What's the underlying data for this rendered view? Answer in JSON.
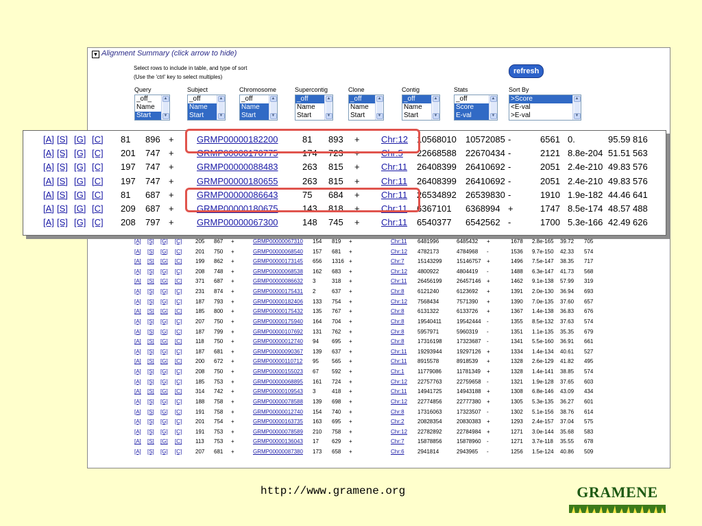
{
  "summary": {
    "title": "Alignment Summary",
    "hint": "(click arrow to hide)",
    "instruction_1": "Select rows to include in table, and type of sort",
    "instruction_2": "(Use the 'ctrl' key to select multiples)",
    "refresh_label": "refresh",
    "arrow_glyph": "▼"
  },
  "selectors": [
    {
      "label": "Query",
      "options": [
        "_off_",
        "Name",
        "Start"
      ],
      "selected": [
        2
      ]
    },
    {
      "label": "Subject",
      "options": [
        "_off",
        "Name",
        "Start"
      ],
      "selected": [
        1,
        2
      ]
    },
    {
      "label": "Chromosome",
      "options": [
        "_off",
        "Name",
        "Start"
      ],
      "selected": [
        1,
        2
      ]
    },
    {
      "label": "Supercontig",
      "options": [
        "_off",
        "Name",
        "Start"
      ],
      "selected": [
        0
      ]
    },
    {
      "label": "Clone",
      "options": [
        "_off",
        "Name",
        "Start"
      ],
      "selected": [
        0
      ]
    },
    {
      "label": "Contig",
      "options": [
        "_off",
        "Name",
        "Start"
      ],
      "selected": [
        0
      ]
    },
    {
      "label": "Stats",
      "options": [
        "_off",
        "Score",
        "E-val"
      ],
      "selected": [
        1,
        2
      ]
    },
    {
      "label": "Sort By",
      "options": [
        ">Score",
        "<E-val",
        ">E-val"
      ],
      "selected": [
        0
      ]
    }
  ],
  "popup_rows": [
    [
      "[A]",
      "[S]",
      "[G]",
      "[C]",
      "81",
      "896",
      "+",
      "GRMP00000182200",
      "81",
      "893",
      "+",
      "Chr:12",
      "10568010",
      "10572085",
      "-",
      "6561",
      "0.",
      "95.59",
      "816"
    ],
    [
      "[A]",
      "[S]",
      "[G]",
      "[C]",
      "201",
      "747",
      "+",
      "GRMP00000170775",
      "174",
      "723",
      "+",
      "Chr:5",
      "22668588",
      "22670434",
      "-",
      "2121",
      "8.8e-204",
      "51.51",
      "563"
    ],
    [
      "[A]",
      "[S]",
      "[G]",
      "[C]",
      "197",
      "747",
      "+",
      "GRMP00000088483",
      "263",
      "815",
      "+",
      "Chr:11",
      "26408399",
      "26410692",
      "-",
      "2051",
      "2.4e-210",
      "49.83",
      "576"
    ],
    [
      "[A]",
      "[S]",
      "[G]",
      "[C]",
      "197",
      "747",
      "+",
      "GRMP00000180655",
      "263",
      "815",
      "+",
      "Chr:11",
      "26408399",
      "26410692",
      "-",
      "2051",
      "2.4e-210",
      "49.83",
      "576"
    ],
    [
      "[A]",
      "[S]",
      "[G]",
      "[C]",
      "81",
      "687",
      "+",
      "GRMP00000086643",
      "75",
      "684",
      "+",
      "Chr:11",
      "26534892",
      "26539830",
      "-",
      "1910",
      "1.9e-182",
      "44.46",
      "641"
    ],
    [
      "[A]",
      "[S]",
      "[G]",
      "[C]",
      "209",
      "687",
      "+",
      "GRMP00000180675",
      "143",
      "818",
      "+",
      "Chr:11",
      "6367101",
      "6368994",
      "+",
      "1747",
      "8.5e-174",
      "48.57",
      "488"
    ],
    [
      "[A]",
      "[S]",
      "[G]",
      "[C]",
      "208",
      "797",
      "+",
      "GRMP00000067300",
      "148",
      "745",
      "+",
      "Chr:11",
      "6540377",
      "6542562",
      "-",
      "1700",
      "5.3e-166",
      "42.49",
      "626"
    ]
  ],
  "table_rows": [
    [
      "[A]",
      "[S]",
      "[G]",
      "[C]",
      "205",
      "867",
      "+",
      "GRMP00000067310",
      "154",
      "819",
      "+",
      "Chr:11",
      "6481996",
      "6485432",
      "+",
      "1678",
      "2.8e-165",
      "39.72",
      "705"
    ],
    [
      "[A]",
      "[S]",
      "[G]",
      "[C]",
      "201",
      "750",
      "+",
      "GRMP00000068540",
      "157",
      "681",
      "+",
      "Chr:12",
      "4782173",
      "4784968",
      "-",
      "1536",
      "9.7e-150",
      "42.33",
      "574"
    ],
    [
      "[A]",
      "[S]",
      "[G]",
      "[C]",
      "199",
      "862",
      "+",
      "GRMP00000173145",
      "656",
      "1316",
      "+",
      "Chr:7",
      "15143299",
      "15146757",
      "+",
      "1496",
      "7.5e-147",
      "38.35",
      "717"
    ],
    [
      "[A]",
      "[S]",
      "[G]",
      "[C]",
      "208",
      "748",
      "+",
      "GRMP00000068538",
      "162",
      "683",
      "+",
      "Chr:12",
      "4800922",
      "4804419",
      "-",
      "1488",
      "6.3e-147",
      "41.73",
      "568"
    ],
    [
      "[A]",
      "[S]",
      "[G]",
      "[C]",
      "371",
      "687",
      "+",
      "GRMP00000086632",
      "3",
      "318",
      "+",
      "Chr:11",
      "26456199",
      "26457146",
      "+",
      "1462",
      "9.1e-138",
      "57.99",
      "319"
    ],
    [
      "[A]",
      "[S]",
      "[G]",
      "[C]",
      "231",
      "874",
      "+",
      "GRMP00000175431",
      "2",
      "637",
      "+",
      "Chr:8",
      "6121240",
      "6123692",
      "+",
      "1391",
      "2.0e-130",
      "36.94",
      "693"
    ],
    [
      "[A]",
      "[S]",
      "[G]",
      "[C]",
      "187",
      "793",
      "+",
      "GRMP00000182406",
      "133",
      "754",
      "+",
      "Chr:12",
      "7568434",
      "7571390",
      "+",
      "1390",
      "7.0e-135",
      "37.60",
      "657"
    ],
    [
      "[A]",
      "[S]",
      "[G]",
      "[C]",
      "185",
      "800",
      "+",
      "GRMP00000175432",
      "135",
      "767",
      "+",
      "Chr:8",
      "6131322",
      "6133726",
      "+",
      "1367",
      "1.4e-138",
      "36.83",
      "676"
    ],
    [
      "[A]",
      "[S]",
      "[G]",
      "[C]",
      "207",
      "750",
      "+",
      "GRMP00000175940",
      "164",
      "704",
      "+",
      "Chr:8",
      "19540411",
      "19542444",
      "-",
      "1355",
      "8.5e-132",
      "37.63",
      "574"
    ],
    [
      "[A]",
      "[S]",
      "[G]",
      "[C]",
      "187",
      "799",
      "+",
      "GRMP00000107692",
      "131",
      "762",
      "+",
      "Chr:8",
      "5957971",
      "5960319",
      "-",
      "1351",
      "1.1e-135",
      "35.35",
      "679"
    ],
    [
      "[A]",
      "[S]",
      "[G]",
      "[C]",
      "118",
      "750",
      "+",
      "GRMP00000012740",
      "94",
      "695",
      "+",
      "Chr:8",
      "17316198",
      "17323687",
      "-",
      "1341",
      "5.5e-160",
      "36.91",
      "661"
    ],
    [
      "[A]",
      "[S]",
      "[G]",
      "[C]",
      "187",
      "681",
      "+",
      "GRMP00000090367",
      "139",
      "637",
      "+",
      "Chr:11",
      "19293944",
      "19297126",
      "+",
      "1334",
      "1.4e-134",
      "40.61",
      "527"
    ],
    [
      "[A]",
      "[S]",
      "[G]",
      "[C]",
      "200",
      "672",
      "+",
      "GRMP00000110712",
      "95",
      "565",
      "+",
      "Chr:11",
      "8915578",
      "8918539",
      "+",
      "1328",
      "2.6e-129",
      "41.82",
      "495"
    ],
    [
      "[A]",
      "[S]",
      "[G]",
      "[C]",
      "208",
      "750",
      "+",
      "GRMP00000155023",
      "67",
      "592",
      "+",
      "Chr:1",
      "11779086",
      "11781349",
      "+",
      "1328",
      "1.4e-141",
      "38.85",
      "574"
    ],
    [
      "[A]",
      "[S]",
      "[G]",
      "[C]",
      "185",
      "753",
      "+",
      "GRMP00000068895",
      "161",
      "724",
      "+",
      "Chr:12",
      "22757763",
      "22759658",
      "-",
      "1321",
      "1.9e-128",
      "37.65",
      "603"
    ],
    [
      "[A]",
      "[S]",
      "[G]",
      "[C]",
      "314",
      "742",
      "+",
      "GRMP00000109543",
      "3",
      "418",
      "+",
      "Chr:11",
      "14941725",
      "14943188",
      "+",
      "1308",
      "6.8e-146",
      "43.09",
      "434"
    ],
    [
      "[A]",
      "[S]",
      "[G]",
      "[C]",
      "188",
      "758",
      "+",
      "GRMP00000078588",
      "139",
      "698",
      "+",
      "Chr:12",
      "22774856",
      "22777380",
      "+",
      "1305",
      "5.3e-135",
      "36.27",
      "601"
    ],
    [
      "[A]",
      "[S]",
      "[G]",
      "[C]",
      "191",
      "758",
      "+",
      "GRMP00000012740",
      "154",
      "740",
      "+",
      "Chr:8",
      "17316063",
      "17323507",
      "-",
      "1302",
      "5.1e-156",
      "38.76",
      "614"
    ],
    [
      "[A]",
      "[S]",
      "[G]",
      "[C]",
      "201",
      "754",
      "+",
      "GRMP00000163735",
      "163",
      "695",
      "+",
      "Chr:2",
      "20828354",
      "20830383",
      "+",
      "1293",
      "2.4e-157",
      "37.04",
      "575"
    ],
    [
      "[A]",
      "[S]",
      "[G]",
      "[C]",
      "191",
      "753",
      "+",
      "GRMP00000078589",
      "210",
      "758",
      "+",
      "Chr:12",
      "22782892",
      "22784984",
      "+",
      "1271",
      "3.0e-144",
      "35.68",
      "583"
    ],
    [
      "[A]",
      "[S]",
      "[G]",
      "[C]",
      "113",
      "753",
      "+",
      "GRMP00000136043",
      "17",
      "629",
      "+",
      "Chr:7",
      "15878856",
      "15878960",
      "-",
      "1271",
      "3.7e-118",
      "35.55",
      "678"
    ],
    [
      "[A]",
      "[S]",
      "[G]",
      "[C]",
      "207",
      "681",
      "+",
      "GRMP00000087380",
      "173",
      "658",
      "+",
      "Chr:6",
      "2941814",
      "2943965",
      "-",
      "1256",
      "1.5e-124",
      "40.86",
      "509"
    ]
  ],
  "footer": {
    "url": "http://www.gramene.org",
    "logo_text": "GRAMENE"
  },
  "colors": {
    "background": "#ffffcc",
    "link": "#1a1aa6",
    "highlight": "#e0544d",
    "selected": "#316ac5",
    "logo_green": "#1e5a14"
  }
}
